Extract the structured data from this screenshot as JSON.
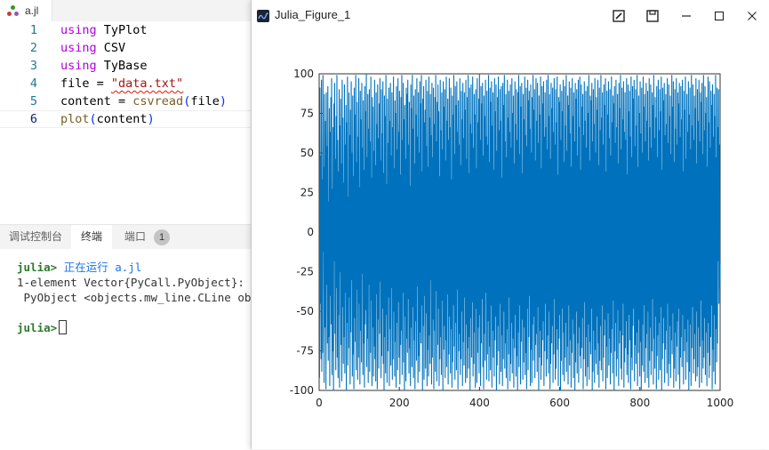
{
  "editor": {
    "tab": {
      "filename": "a.jl"
    },
    "lines": [
      {
        "num": "1",
        "parts": [
          {
            "t": "using",
            "c": "kw"
          },
          {
            "t": " TyPlot",
            "c": ""
          }
        ]
      },
      {
        "num": "2",
        "parts": [
          {
            "t": "using",
            "c": "kw"
          },
          {
            "t": " CSV",
            "c": ""
          }
        ]
      },
      {
        "num": "3",
        "parts": [
          {
            "t": "using",
            "c": "kw"
          },
          {
            "t": " TyBase",
            "c": ""
          }
        ]
      },
      {
        "num": "4",
        "parts": [
          {
            "t": "file = ",
            "c": ""
          },
          {
            "t": "\"data.txt\"",
            "c": "str"
          }
        ]
      },
      {
        "num": "5",
        "parts": [
          {
            "t": "content = ",
            "c": ""
          },
          {
            "t": "csvread",
            "c": "fn"
          },
          {
            "t": "(",
            "c": "pn"
          },
          {
            "t": "file",
            "c": ""
          },
          {
            "t": ")",
            "c": "pn"
          }
        ]
      },
      {
        "num": "6",
        "parts": [
          {
            "t": "plot",
            "c": "fn"
          },
          {
            "t": "(",
            "c": "pn"
          },
          {
            "t": "content",
            "c": ""
          },
          {
            "t": ")",
            "c": "pn"
          }
        ]
      }
    ]
  },
  "panel": {
    "tabs": {
      "debug_console": "调试控制台",
      "terminal": "终端",
      "ports": "端口",
      "ports_count": "1"
    },
    "terminal": {
      "prompt": "julia>",
      "run_text": "正在运行 a.jl",
      "output1": "1-element Vector{PyCall.PyObject}:",
      "output2": " PyObject <objects.mw_line.CLine obj"
    }
  },
  "figure": {
    "title": "Julia_Figure_1",
    "icons": [
      "edit-icon",
      "save-icon",
      "minimize-icon",
      "maximize-icon",
      "close-icon"
    ],
    "line_color": "#0072bd"
  },
  "chart_data": {
    "type": "line",
    "title": "",
    "xlabel": "",
    "ylabel": "",
    "xlim": [
      0,
      1000
    ],
    "ylim": [
      -100,
      100
    ],
    "x_ticks": [
      "0",
      "200",
      "400",
      "600",
      "800",
      "1000"
    ],
    "y_ticks": [
      "100",
      "75",
      "50",
      "25",
      "0",
      "-25",
      "-50",
      "-75",
      "-100"
    ],
    "grid": false,
    "series": [
      {
        "x_range": [
          1,
          1000
        ],
        "description_of_values": "1000 random integers roughly uniform in [-100, 100]",
        "values": [
          -92,
          91,
          -45,
          48,
          -80,
          96,
          -88,
          33,
          -76,
          99,
          -12,
          41,
          -95,
          87,
          -60,
          70,
          -28,
          -99,
          88,
          -33,
          54,
          -70,
          92,
          -81,
          19,
          -66,
          78,
          -97,
          63,
          -40,
          85,
          -58,
          97,
          -90,
          27,
          -75,
          66,
          -100,
          81,
          -18,
          94,
          -64,
          46,
          -87,
          73,
          -35,
          99,
          -79,
          58,
          -92,
          38,
          -52,
          90,
          -98,
          67,
          -25,
          84,
          -71,
          43,
          -94,
          96,
          -47,
          72,
          -83,
          31,
          -66,
          93,
          -89,
          55,
          -38,
          80,
          -100,
          69,
          -57,
          98,
          -84,
          22,
          -73,
          88,
          -41,
          61,
          -96,
          77,
          -63,
          95,
          -30,
          50,
          -91,
          86,
          -77,
          35,
          -99,
          91,
          -54,
          74,
          -69,
          99,
          -87,
          44,
          -36,
          82,
          -93,
          60,
          -79,
          97,
          -45,
          28,
          -96,
          89,
          -62,
          71,
          -82,
          94,
          -26,
          53,
          -90,
          83,
          -70,
          39,
          -98,
          92,
          -58,
          76,
          -49,
          100,
          -85,
          47,
          -67,
          87,
          -95,
          65,
          -33,
          90,
          -88,
          57,
          -76,
          98,
          -43,
          34,
          -97,
          85,
          -60,
          79,
          -91,
          51,
          -72,
          96,
          -80,
          42,
          -94,
          88,
          -39,
          68,
          -99,
          93,
          -55,
          59,
          -86,
          81,
          -64,
          97,
          -31,
          45,
          -92,
          90,
          -78,
          62,
          -48,
          95,
          -83,
          37,
          -100,
          86,
          -66,
          73,
          -89,
          99,
          -52,
          30,
          -95,
          84,
          -75,
          56,
          -41,
          91,
          -97,
          70,
          -61,
          94,
          -84,
          48,
          -35,
          88,
          -93,
          66,
          -80,
          98,
          -50,
          40,
          -91,
          83,
          -69,
          75,
          -98,
          92,
          -57,
          52,
          -87,
          97,
          -44,
          63,
          -79,
          89,
          -96,
          36,
          -71,
          85,
          -62,
          99,
          -90,
          58,
          -38,
          94,
          -82,
          71,
          -100,
          80,
          -53,
          46,
          -94,
          91,
          -67,
          87,
          -76,
          96,
          -42,
          55,
          -89,
          82,
          -73,
          29,
          -97,
          93,
          -60,
          78,
          -85,
          99,
          -47,
          65,
          -92,
          86,
          -68,
          43,
          -99,
          90,
          -56,
          74,
          -81,
          97,
          -34,
          60,
          -95,
          88,
          -78,
          50,
          -88,
          95,
          -63,
          81,
          -70,
          99,
          -46,
          38,
          -100,
          84,
          -59,
          92,
          -93,
          69,
          -40,
          77,
          -86,
          96,
          -51,
          54,
          -97,
          89,
          -74,
          41,
          -91,
          98,
          -65,
          72,
          -83,
          87,
          -30,
          61,
          -96,
          94,
          -79,
          47,
          -55,
          91,
          -99,
          68,
          -62,
          85,
          -88,
          99,
          -37,
          57,
          -94,
          82,
          -71,
          93,
          -48,
          76,
          -97,
          35,
          -80,
          96,
          -66,
          64,
          -90,
          88,
          -43,
          52,
          -100,
          95,
          -74,
          79,
          -59,
          90,
          -92,
          45,
          -68,
          98,
          -85,
          70,
          -39,
          84,
          -96,
          58,
          -77,
          97,
          -53,
          66,
          -89,
          91,
          -61,
          33,
          -98,
          86,
          -82,
          74,
          -46,
          99,
          -72,
          49,
          -93,
          92,
          -57,
          80,
          -87,
          95,
          -36,
          63,
          -99,
          83,
          -75,
          55,
          -64,
          97,
          -90,
          42,
          -80,
          89,
          -50,
          71,
          -97,
          94,
          -69,
          59,
          -84,
          88,
          -41,
          77,
          -95,
          96,
          -58,
          46,
          -92,
          85,
          -73,
          99,
          -86,
          37,
          -66,
          91,
          -100,
          68,
          -54,
          93,
          -79,
          62,
          -44,
          98,
          -91,
          53,
          -83,
          87,
          -63,
          74,
          -98,
          90,
          -48,
          40,
          -95,
          97,
          -76,
          69,
          -60,
          84,
          -89,
          100,
          -52,
          58,
          -97,
          92,
          -70,
          81,
          -42,
          94,
          -85,
          48,
          -99,
          86,
          -64,
          73,
          -81,
          96,
          -38,
          60,
          -93,
          89,
          -77,
          55,
          -56,
          99,
          -94,
          44,
          -72,
          91,
          -87,
          82,
          -46,
          95,
          -98,
          67,
          -62,
          88,
          -79,
          39,
          -91,
          97,
          -68,
          76,
          -53,
          93,
          -100,
          51,
          -84,
          85,
          -59,
          98,
          -75,
          64,
          -96,
          90,
          -45,
          70,
          -88,
          92,
          -65,
          34,
          -97,
          94,
          -80,
          80,
          -50,
          99,
          -86,
          57,
          -70,
          87,
          -92,
          47,
          -61,
          96,
          -99,
          72,
          -77,
          89,
          -41,
          63,
          -94,
          93,
          -83,
          53,
          -57,
          97,
          -89,
          75,
          -67,
          86,
          -98,
          43,
          -73,
          95,
          -52,
          68,
          -91,
          90,
          -78,
          58,
          -100,
          88,
          -63,
          99,
          -85,
          49,
          -46,
          92,
          -96,
          79,
          -69,
          94,
          -55,
          37,
          -93,
          87,
          -82,
          71,
          -60,
          98,
          -90,
          61,
          -76,
          91,
          -99,
          54,
          -48,
          96,
          -87,
          83,
          -66,
          89,
          -40,
          65,
          -97,
          93,
          -74,
          50,
          -95,
          85,
          -58,
          99,
          -81,
          77,
          -53,
          90,
          -92,
          45,
          -71,
          97,
          -64,
          70,
          -88,
          94,
          -47,
          56,
          -100,
          86,
          -79,
          74,
          -62,
          98,
          -93,
          40,
          -84,
          92,
          -68,
          81,
          -56,
          95,
          -97,
          60,
          -75,
          88,
          -45,
          66,
          -91,
          96,
          -80,
          52,
          -65,
          99,
          -89,
          73,
          -50,
          87,
          -99,
          46,
          -83,
          94,
          -70,
          78,
          -59,
          91,
          -95,
          63,
          -77,
          97,
          -42,
          55,
          -93,
          90,
          -86,
          69,
          -61,
          98,
          -74,
          36,
          -97,
          85,
          -67,
          82,
          -52,
          93,
          -100,
          58,
          -81,
          89,
          -48,
          76,
          -90,
          96,
          -63,
          44,
          -94,
          92,
          -79,
          67,
          -57,
          99,
          -88,
          51,
          -72,
          86,
          -96,
          80,
          -46,
          95,
          -84,
          62,
          -68,
          91,
          -98,
          41,
          -76,
          97,
          -55,
          73,
          -92,
          88,
          -64,
          57,
          -100,
          94,
          -82,
          84,
          -50,
          90,
          -89,
          48,
          -70,
          96,
          -95,
          66,
          -60,
          98,
          -78,
          39,
          -86,
          93,
          -73,
          79,
          -54,
          87,
          -99,
          61,
          -80,
          95,
          -44,
          70,
          -91,
          89,
          -66,
          53,
          -97,
          92,
          -85,
          75,
          -58,
          99,
          -93,
          45,
          -69,
          86,
          -77,
          83,
          -48,
          94,
          -100,
          57,
          -88,
          90,
          -62,
          68,
          -95,
          97,
          -74,
          50,
          -83,
          85,
          -53,
          77,
          -90,
          96,
          -70,
          42,
          -98,
          91,
          -81,
          64,
          -59,
          99,
          -87,
          72,
          -46,
          88,
          -94,
          55,
          -79,
          93,
          -65,
          80,
          -55,
          97,
          -99,
          38,
          -72,
          89,
          -92,
          74,
          -51,
          95,
          -84,
          59,
          -67,
          90,
          -96,
          48,
          -76,
          98,
          -61,
          69,
          -89,
          86,
          -43,
          81,
          -100,
          92,
          -75,
          56,
          -57,
          96,
          -91,
          66,
          -80,
          87,
          -49,
          43,
          -97,
          94,
          -70,
          78,
          -62,
          99,
          -86,
          52,
          -93,
          91,
          -65,
          71,
          -45,
          95,
          -98,
          63,
          -82,
          88,
          -73,
          58,
          -56,
          97,
          -90,
          36,
          -77,
          93,
          -95,
          76,
          -52,
          89,
          -68,
          60,
          -99,
          98,
          -79,
          47,
          -87,
          92,
          -59,
          84,
          -48,
          96,
          -94,
          54,
          -71,
          90,
          -83,
          67,
          -63,
          99,
          -97,
          41,
          -76,
          86,
          -55,
          75,
          -91,
          95,
          -69,
          62,
          -100,
          91,
          -84,
          50,
          -58,
          98,
          -88,
          79,
          -46,
          87,
          -95,
          57,
          -73,
          94,
          -64,
          70,
          -92,
          89,
          -50,
          45,
          -98,
          97,
          -81,
          66,
          -60,
          93,
          -90,
          53,
          -75,
          88,
          -42,
          80,
          -96,
          99,
          -67,
          59,
          -86,
          85,
          -53,
          72,
          -99,
          92,
          -78,
          47,
          -65,
          96,
          -93,
          64,
          -57,
          90,
          -87,
          76,
          -47,
          98,
          -100,
          39,
          -80,
          91,
          -70,
          83,
          -54,
          94,
          -95,
          61,
          -74,
          87,
          -62,
          68,
          -89,
          97,
          -45,
          56,
          -97,
          93,
          -83,
          73,
          -59,
          86,
          -92,
          49,
          -68,
          99,
          -77,
          79,
          -51,
          95,
          -98,
          44,
          -86,
          90,
          -63,
          65,
          -94,
          97,
          -72,
          55,
          -56,
          88,
          -90,
          81,
          -48,
          94,
          -99,
          60,
          -79,
          92,
          -66,
          71,
          -85,
          96,
          -52,
          38,
          -96,
          89,
          -75,
          77,
          -61,
          98,
          -93,
          46,
          -69,
          87,
          -82,
          63,
          -55,
          95,
          -100,
          74,
          -88,
          91,
          -58,
          52,
          -97,
          99,
          -73,
          67,
          -47,
          93,
          -89,
          58,
          -80,
          86,
          -64,
          78,
          -94,
          97,
          -50,
          43,
          -91,
          90,
          -85,
          70,
          -60,
          96,
          -98,
          57,
          -72,
          88,
          -43,
          82,
          -95,
          94,
          -68,
          49,
          -86,
          99,
          -79,
          64,
          -54,
          92,
          -90,
          75,
          -63,
          85,
          -97,
          41,
          -76,
          98,
          -57,
          69,
          -92,
          95,
          -84,
          53,
          -66,
          89,
          -46,
          80,
          -99,
          93,
          -74,
          60,
          -88,
          87,
          -52,
          73,
          -96,
          99,
          -61,
          47,
          -82,
          91,
          -70,
          66,
          -18,
          90,
          -45,
          55,
          -35,
          -20
        ]
      }
    ]
  }
}
